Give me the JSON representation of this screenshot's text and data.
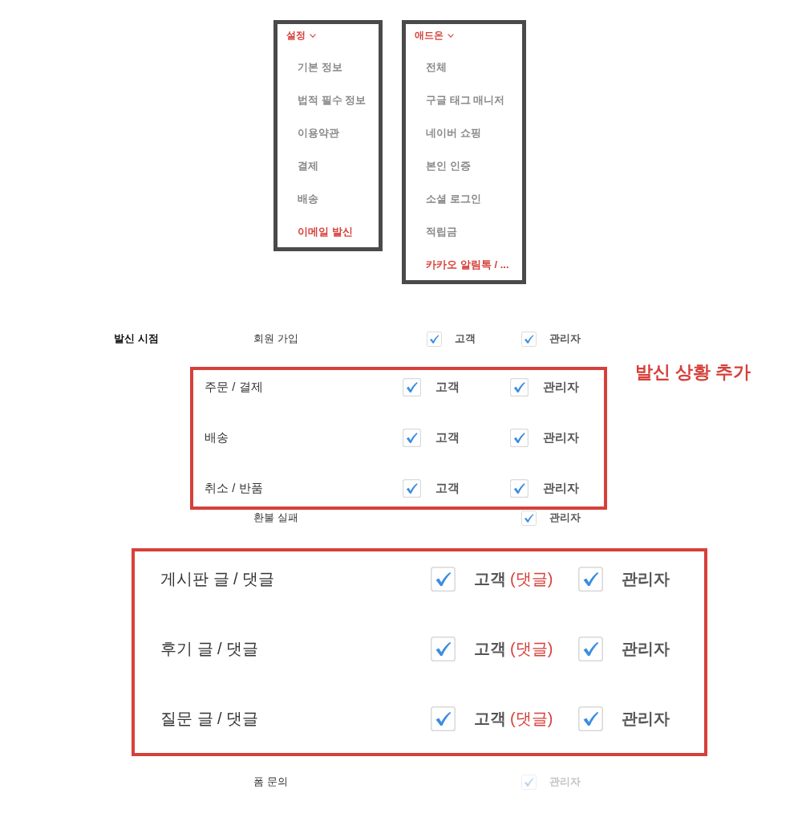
{
  "menus": [
    {
      "title": "설정",
      "items": [
        {
          "label": "기본 정보",
          "selected": false
        },
        {
          "label": "법적 필수 정보",
          "selected": false
        },
        {
          "label": "이용약관",
          "selected": false
        },
        {
          "label": "결제",
          "selected": false
        },
        {
          "label": "배송",
          "selected": false
        },
        {
          "label": "이메일 발신",
          "selected": true
        }
      ]
    },
    {
      "title": "애드온",
      "items": [
        {
          "label": "전체",
          "selected": false
        },
        {
          "label": "구글 태그 매니저",
          "selected": false
        },
        {
          "label": "네이버 쇼핑",
          "selected": false
        },
        {
          "label": "본인 인증",
          "selected": false
        },
        {
          "label": "소셜 로그인",
          "selected": false
        },
        {
          "label": "적립금",
          "selected": false
        },
        {
          "label": "카카오 알림톡 / ...",
          "selected": true
        }
      ]
    }
  ],
  "blocks": [
    {
      "kind": "plain",
      "rows": [
        {
          "heading": "발신 시점",
          "label": "회원 가입",
          "customer": {
            "label": "고객",
            "checked": true,
            "disabled": false
          },
          "admin": {
            "label": "관리자",
            "checked": true,
            "disabled": false
          }
        }
      ]
    },
    {
      "kind": "highlighted",
      "callout": "발신 상황 추가",
      "rows": [
        {
          "label": "주문 / 결제",
          "customer": {
            "label": "고객",
            "checked": true,
            "disabled": false
          },
          "admin": {
            "label": "관리자",
            "checked": true,
            "disabled": false
          }
        },
        {
          "label": "배송",
          "customer": {
            "label": "고객",
            "checked": true,
            "disabled": false
          },
          "admin": {
            "label": "관리자",
            "checked": true,
            "disabled": false
          }
        },
        {
          "label": "취소 / 반품",
          "customer": {
            "label": "고객",
            "checked": true,
            "disabled": false
          },
          "admin": {
            "label": "관리자",
            "checked": true,
            "disabled": false
          }
        }
      ]
    },
    {
      "kind": "plain",
      "rows": [
        {
          "label": "환불 실패",
          "admin": {
            "label": "관리자",
            "checked": true,
            "disabled": false
          }
        }
      ]
    },
    {
      "kind": "enlarged",
      "rows": [
        {
          "label": "게시판 글 / 댓글",
          "customer": {
            "label": "고객",
            "note": "(댓글)",
            "checked": true,
            "disabled": false
          },
          "admin": {
            "label": "관리자",
            "checked": true,
            "disabled": false
          }
        },
        {
          "label": "후기 글 / 댓글",
          "customer": {
            "label": "고객",
            "note": "(댓글)",
            "checked": true,
            "disabled": false
          },
          "admin": {
            "label": "관리자",
            "checked": true,
            "disabled": false
          }
        },
        {
          "label": "질문 글 / 댓글",
          "customer": {
            "label": "고객",
            "note": "(댓글)",
            "checked": true,
            "disabled": false
          },
          "admin": {
            "label": "관리자",
            "checked": true,
            "disabled": false
          }
        }
      ]
    },
    {
      "kind": "plain",
      "rows": [
        {
          "label": "폼 문의",
          "admin": {
            "label": "관리자",
            "checked": true,
            "disabled": true
          }
        }
      ]
    }
  ]
}
